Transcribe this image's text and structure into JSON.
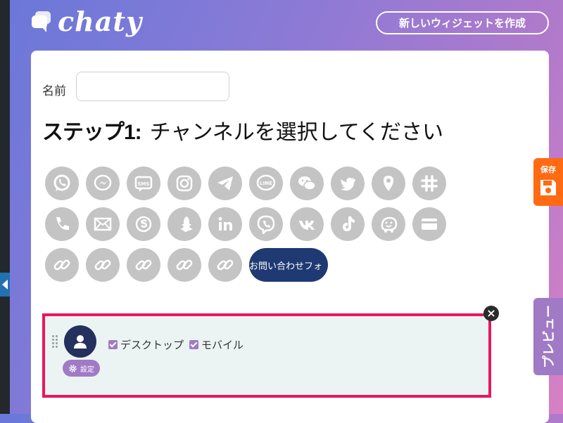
{
  "header": {
    "logo_text": "chaty",
    "create_widget_label": "新しいウィジェットを作成"
  },
  "form": {
    "name_label": "名前",
    "name_value": ""
  },
  "step": {
    "label": "ステップ1:",
    "text": "チャンネルを選択してください"
  },
  "channels": {
    "row1": [
      "whatsapp-icon",
      "messenger-icon",
      "sms-icon",
      "instagram-icon",
      "telegram-icon",
      "line-icon",
      "wechat-icon",
      "twitter-icon",
      "location-icon",
      "slack-icon"
    ],
    "row2": [
      "phone-icon",
      "email-icon",
      "skype-icon",
      "snapchat-icon",
      "linkedin-icon",
      "viber-icon",
      "vk-icon",
      "tiktok-icon",
      "waze-icon",
      "card-icon"
    ],
    "row3": [
      "link-icon",
      "link-icon",
      "link-icon",
      "link-icon",
      "link-icon"
    ],
    "sms_text": "SMS",
    "line_text": "LINE",
    "contact_form_label": "お問い合わせフォ"
  },
  "selected_channel": {
    "settings_label": "設定",
    "desktop_label": "デスクトップ",
    "mobile_label": "モバイル",
    "desktop_checked": true,
    "mobile_checked": true
  },
  "side_tabs": {
    "save_label": "保存",
    "preview_label": "プレビュー"
  },
  "colors": {
    "accent_purple": "#a17ac6",
    "save_orange": "#ff6a13",
    "contact_form_navy": "#1f3a72",
    "highlight_border": "#e8175d"
  }
}
